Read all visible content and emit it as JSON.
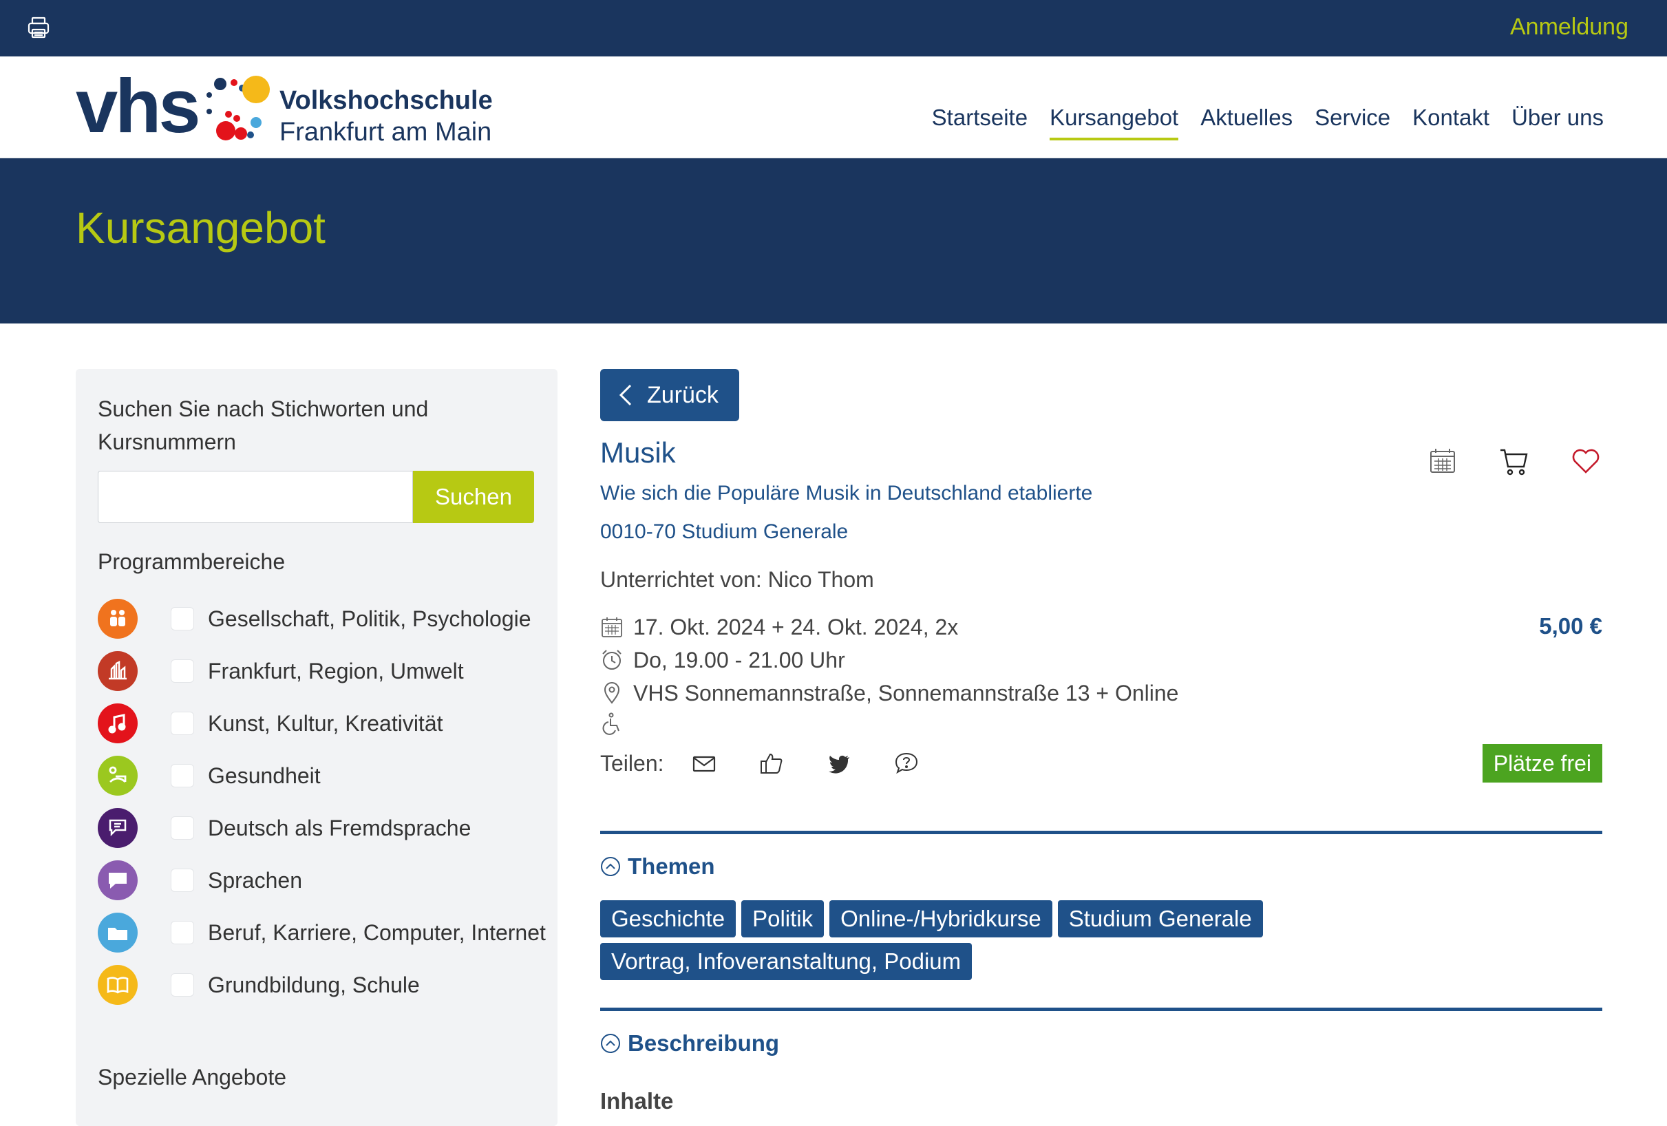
{
  "topbar": {
    "login": "Anmeldung"
  },
  "logo": {
    "vhs": "vhs",
    "line1": "Volkshochschule",
    "line2": "Frankfurt am Main"
  },
  "nav": [
    {
      "label": "Startseite",
      "active": false
    },
    {
      "label": "Kursangebot",
      "active": true
    },
    {
      "label": "Aktuelles",
      "active": false
    },
    {
      "label": "Service",
      "active": false
    },
    {
      "label": "Kontakt",
      "active": false
    },
    {
      "label": "Über uns",
      "active": false
    }
  ],
  "hero": {
    "title": "Kursangebot"
  },
  "sidebar": {
    "search_label": "Suchen Sie nach Stichworten und Kursnummern",
    "search_value": "",
    "search_button": "Suchen",
    "programs_title": "Programmbereiche",
    "programs": [
      {
        "label": "Gesellschaft, Politik, Psychologie",
        "color": "#f0731e"
      },
      {
        "label": "Frankfurt, Region, Umwelt",
        "color": "#c23a26"
      },
      {
        "label": "Kunst, Kultur, Kreativität",
        "color": "#e3131b"
      },
      {
        "label": "Gesundheit",
        "color": "#9bc81f"
      },
      {
        "label": "Deutsch als Fremdsprache",
        "color": "#4a1d6e"
      },
      {
        "label": "Sprachen",
        "color": "#8a5bb0"
      },
      {
        "label": "Beruf, Karriere, Computer, Internet",
        "color": "#4aa8dc"
      },
      {
        "label": "Grundbildung, Schule",
        "color": "#f5b919"
      }
    ],
    "special_title": "Spezielle Angebote"
  },
  "course": {
    "back": "Zurück",
    "title": "Musik",
    "subtitle": "Wie sich die Populäre Musik in Deutschland etablierte",
    "number": "0010-70 Studium Generale",
    "teacher": "Unterrichtet von: Nico Thom",
    "date": "17. Okt. 2024 + 24. Okt. 2024, 2x",
    "time": "Do, 19.00 - 21.00 Uhr",
    "location": "VHS Sonnemannstraße, Sonnemannstraße 13 + Online",
    "price": "5,00 €",
    "share_label": "Teilen:",
    "seats": "Plätze frei"
  },
  "themes": {
    "title": "Themen",
    "tags": [
      "Geschichte",
      "Politik",
      "Online-/Hybridkurse",
      "Studium Generale",
      "Vortrag, Infoveranstaltung, Podium"
    ]
  },
  "description": {
    "title": "Beschreibung",
    "subtitle": "Inhalte"
  },
  "colors": {
    "navy": "#1a355e",
    "blue": "#1f5189",
    "lime": "#b7c913",
    "green": "#4ca420"
  }
}
